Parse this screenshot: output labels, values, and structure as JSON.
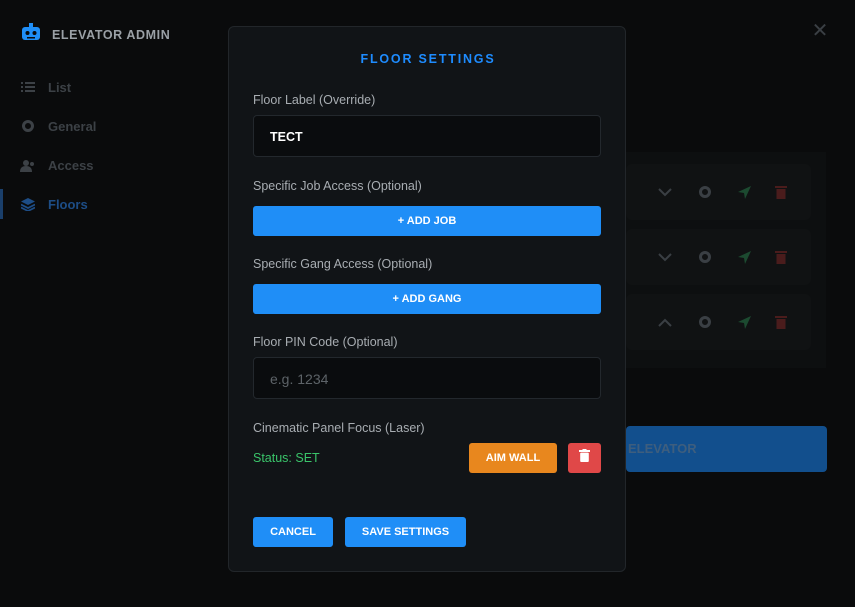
{
  "app": {
    "title": "ELEVATOR ADMIN",
    "logo_icon": "robot-icon"
  },
  "sidebar": {
    "items": [
      {
        "label": "List",
        "icon": "list-icon",
        "active": false
      },
      {
        "label": "General",
        "icon": "gear-icon",
        "active": false
      },
      {
        "label": "Access",
        "icon": "users-icon",
        "active": false
      },
      {
        "label": "Floors",
        "icon": "layers-icon",
        "active": true
      }
    ]
  },
  "background": {
    "create_button_label": "ELEVATOR",
    "floor_row_icons": [
      "chevron-down-icon",
      "chevron-up-icon",
      "gear-icon",
      "location-arrow-icon",
      "trash-icon"
    ]
  },
  "modal": {
    "title": "FLOOR SETTINGS",
    "floor_label": {
      "label": "Floor Label (Override)",
      "value": "TECT"
    },
    "job_access": {
      "label": "Specific Job Access (Optional)",
      "button": "+ ADD JOB"
    },
    "gang_access": {
      "label": "Specific Gang Access (Optional)",
      "button": "+ ADD GANG"
    },
    "pin_code": {
      "label": "Floor PIN Code (Optional)",
      "placeholder": "e.g. 1234",
      "value": ""
    },
    "panel_focus": {
      "label": "Cinematic Panel Focus (Laser)",
      "status": "Status: SET",
      "aim_button": "AIM WALL"
    },
    "cancel_label": "CANCEL",
    "save_label": "SAVE SETTINGS"
  },
  "colors": {
    "accent": "#1f8ef7",
    "warning": "#e8871e",
    "danger": "#e04848",
    "success": "#3ac46a"
  }
}
